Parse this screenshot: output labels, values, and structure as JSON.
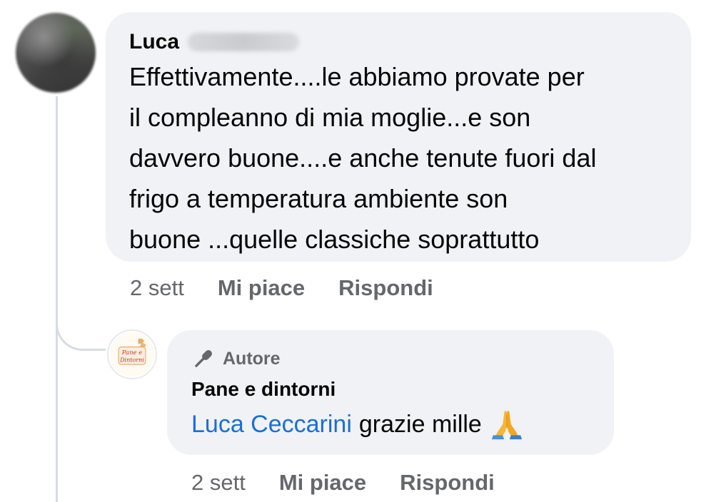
{
  "comment": {
    "author_visible": "Luca",
    "text": "Effettivamente....le abbiamo provate per il compleanno di mia moglie...e son davvero buone....e anche tenute fuori dal frigo a temperatura ambiente son buone ...quelle classiche soprattutto",
    "lines": [
      "Effettivamente....le abbiamo provate per",
      "il compleanno di mia moglie...e son",
      "davvero buone....e anche tenute fuori dal",
      "frigo a temperatura ambiente son",
      "buone ...quelle classiche soprattutto"
    ],
    "time": "2 sett",
    "like_label": "Mi piace",
    "reply_label": "Rispondi"
  },
  "reply": {
    "badge_label": "Autore",
    "page_name": "Pane e dintorni",
    "avatar_text": [
      "Pane e",
      "Dintorni"
    ],
    "mention": "Luca Ceccarini",
    "text": "grazie mille",
    "emoji_icon": "folded-hands-emoji",
    "time": "2 sett",
    "like_label": "Mi piace",
    "reply_label": "Rispondi"
  },
  "colors": {
    "bubble": "#f0f2f5",
    "meta_text": "#65676b",
    "mention": "#1a6ed8",
    "thread_line": "#d8dce1"
  }
}
